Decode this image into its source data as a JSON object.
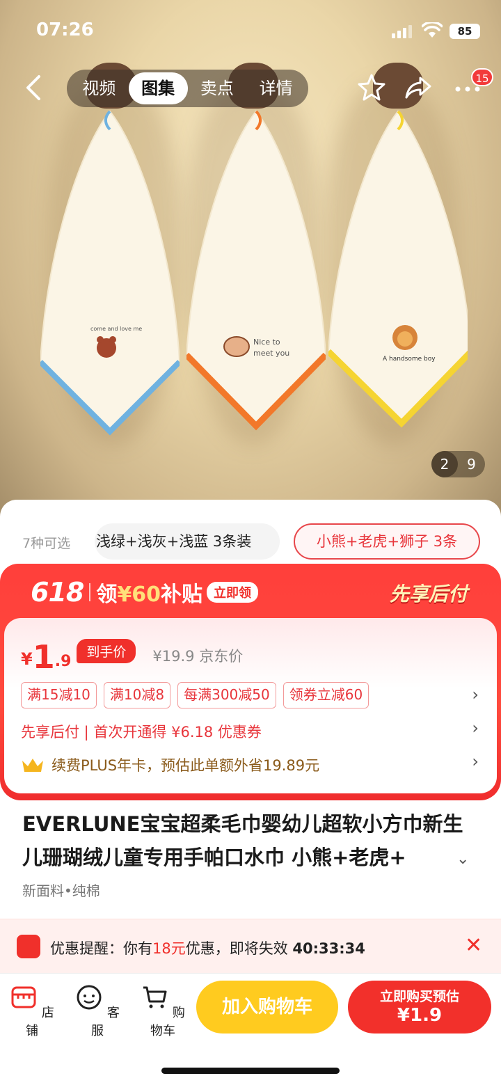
{
  "status_bar": {
    "time": "07:26",
    "battery": "85"
  },
  "nav": {
    "tabs": [
      "视频",
      "图集",
      "卖点",
      "详情"
    ],
    "active_tab": "图集",
    "notification_count": "15"
  },
  "gallery": {
    "current": "2",
    "total": "9"
  },
  "variants": {
    "count_label": "7种可选",
    "options": [
      "浅绿+浅灰+浅蓝 3条装",
      "小熊+老虎+狮子 3条"
    ],
    "selected": "小熊+老虎+狮子 3条"
  },
  "promo": {
    "event": "618",
    "subsidy_prefix": "领",
    "subsidy_amount": "¥60",
    "subsidy_suffix": "补贴",
    "claim_label": "立即领",
    "pay_later_badge": "先享后付"
  },
  "price": {
    "currency": "¥",
    "integer": "1",
    "decimal": ".9",
    "final_label": "到手价",
    "original": "¥19.9 京东价"
  },
  "coupons": [
    "满15减10",
    "满10减8",
    "每满300减50",
    "领券立减60"
  ],
  "pay_later_line": "先享后付 | 首次开通得 ¥6.18 优惠券",
  "plus_line": "续费PLUS年卡，预估此单额外省19.89元",
  "product": {
    "title": "EVERLUNE宝宝超柔毛巾婴幼儿超软小方巾新生儿珊瑚绒儿童专用手帕口水巾 小熊+老虎+",
    "subtitle": "新面料•纯棉"
  },
  "reminder": {
    "prefix": "优惠提醒：你有",
    "amount": "18元",
    "middle": "优惠，即将失效",
    "countdown": "40:33:34"
  },
  "bottom_bar": {
    "shop": "店铺",
    "service": "客服",
    "cart": "购物车",
    "add_to_cart": "加入购物车",
    "buy_now_line1": "立即购买预估",
    "buy_now_line2": "¥1.9"
  },
  "colors": {
    "accent_red": "#f0302b",
    "cart_yellow": "#ffcb1f"
  }
}
